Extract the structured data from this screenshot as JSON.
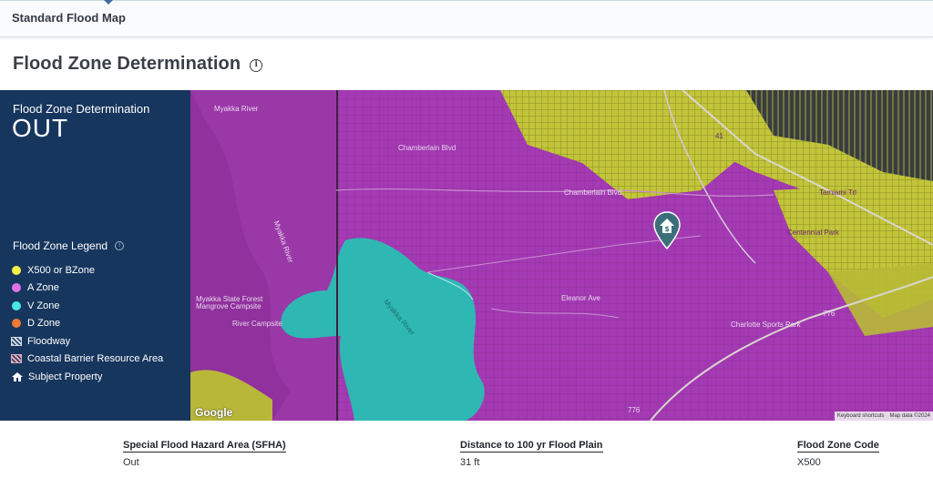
{
  "header": {
    "tab_label": "Standard Flood Map"
  },
  "page": {
    "title": "Flood Zone Determination",
    "info_icon": "info-icon"
  },
  "panel": {
    "determination_label": "Flood Zone Determination",
    "determination_value": "OUT",
    "legend_title": "Flood Zone Legend",
    "legend": [
      {
        "label": "X500 or BZone",
        "color": "#f3f04a",
        "icon": "dot"
      },
      {
        "label": "A Zone",
        "color": "#e070e8",
        "icon": "dot"
      },
      {
        "label": "V Zone",
        "color": "#49e6e6",
        "icon": "dot"
      },
      {
        "label": "D Zone",
        "color": "#f07a32",
        "icon": "dot"
      },
      {
        "label": "Floodway",
        "color": "#cfd8e3",
        "icon": "hatch"
      },
      {
        "label": "Coastal Barrier Resource Area",
        "color": "#e5a8b8",
        "icon": "hatch"
      },
      {
        "label": "Subject Property",
        "color": "#ffffff",
        "icon": "house"
      }
    ]
  },
  "map": {
    "labels": {
      "myakka_river_top": "Myakka River",
      "myakka_river_left": "Myakka River",
      "myakka_river_water": "Myakka River",
      "state_forest": "Myakka State Forest",
      "mangrove": "Mangrove Campsite",
      "river_campsite": "River Campsite",
      "chamberlain_blvd": "Chamberlain Blvd",
      "chamberlain_blvd_2": "Chamberlain Blvd",
      "tamiami": "Tamiami Trl",
      "eleanor_ave": "Eleanor Ave",
      "biscayne": "Biscayne Dr",
      "centennial_park": "Centennial Park",
      "charlotte_sports_park": "Charlotte Sports Park",
      "route_41": "41",
      "route_776": "776",
      "route_776b": "776"
    },
    "google": "Google",
    "keyboard": "Keyboard shortcuts",
    "mapdata": "Map data ©2024",
    "colors": {
      "a_zone": "#a43ab3",
      "x500": "#c7c93a",
      "water": "#2fb8b3",
      "dark": "#2e3034"
    }
  },
  "summary": {
    "sfha_label": "Special Flood Hazard Area (SFHA)",
    "sfha_value": "Out",
    "distance_label": "Distance to 100 yr Flood Plain",
    "distance_value": "31 ft",
    "zone_code_label": "Flood Zone Code",
    "zone_code_value": "X500"
  }
}
